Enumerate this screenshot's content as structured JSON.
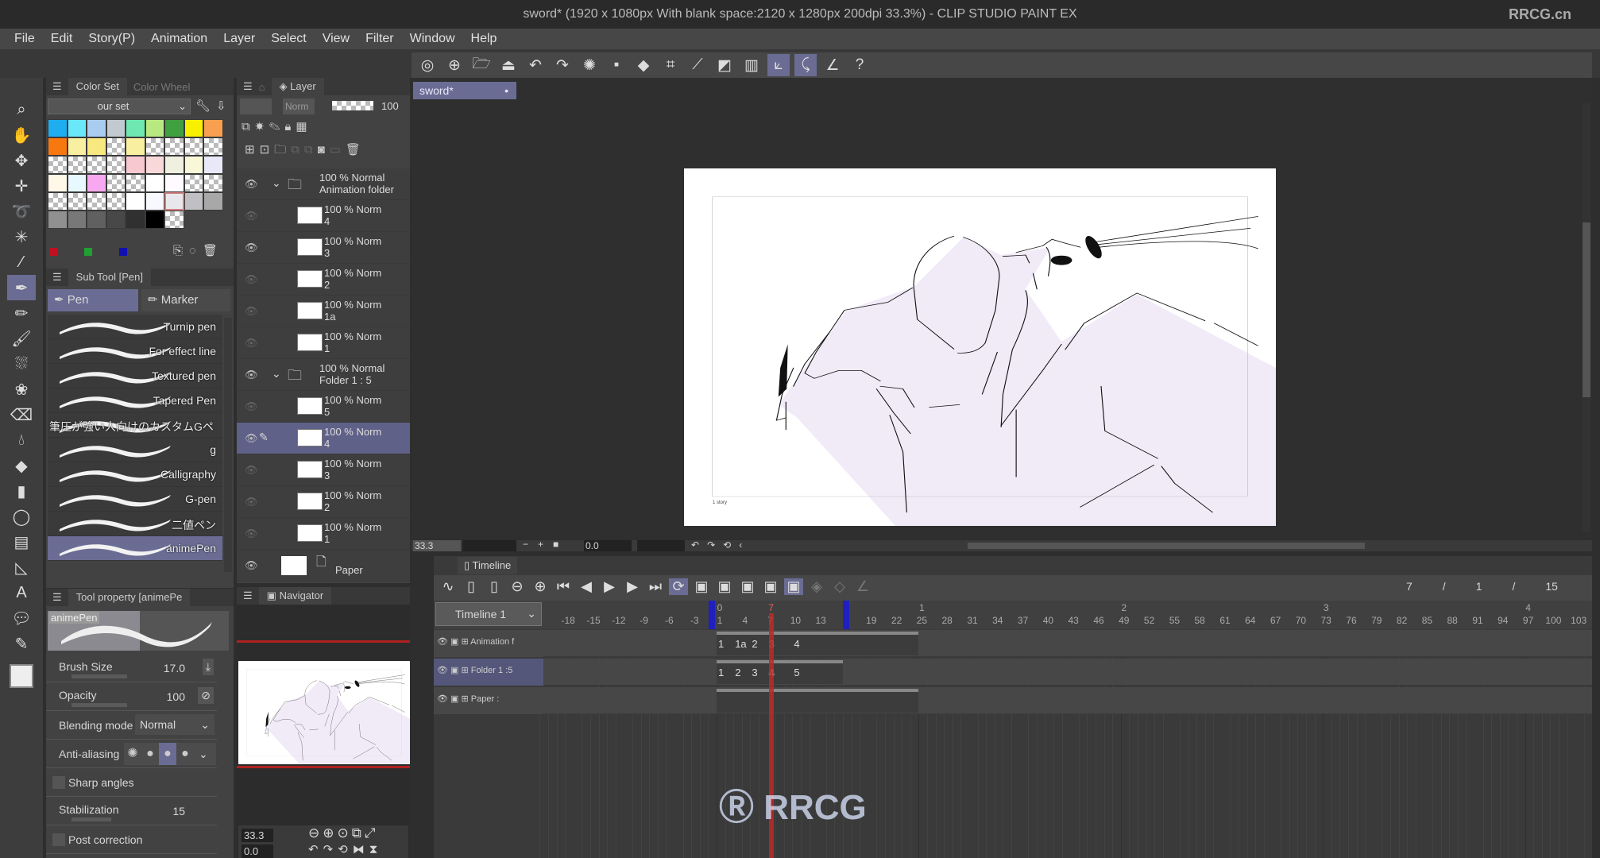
{
  "window": {
    "title": "sword* (1920 x 1080px With blank space:2120 x 1280px 200dpi 33.3%) - CLIP STUDIO PAINT EX",
    "watermark": "RRCG.cn"
  },
  "menu": [
    "File",
    "Edit",
    "Story(P)",
    "Animation",
    "Layer",
    "Select",
    "View",
    "Filter",
    "Window",
    "Help"
  ],
  "command_bar": [
    {
      "icon": "clip-studio-icon"
    },
    {
      "icon": "new-icon"
    },
    {
      "icon": "open-icon"
    },
    {
      "icon": "save-icon"
    },
    {
      "icon": "undo-icon"
    },
    {
      "icon": "redo-icon"
    },
    {
      "icon": "loading-icon"
    },
    {
      "icon": "clear-icon"
    },
    {
      "icon": "fill-icon"
    },
    {
      "icon": "transform-icon"
    },
    {
      "icon": "snap-ruler-icon"
    },
    {
      "icon": "snap-special-icon"
    },
    {
      "icon": "snap-grid-icon"
    },
    {
      "icon": "stabilize-icon",
      "active": true
    },
    {
      "icon": "stabilize-curve-icon",
      "active": true
    },
    {
      "icon": "ruler-pen-icon"
    },
    {
      "icon": "help-icon"
    }
  ],
  "tools": [
    "magnify",
    "hand",
    "move-layer",
    "move",
    "lasso",
    "auto-select",
    "eyedropper",
    "pen",
    "pencil",
    "brush",
    "airbrush",
    "decoration",
    "eraser",
    "blend",
    "fill",
    "gradient",
    "figure",
    "frame",
    "ruler",
    "text",
    "balloon",
    "line-correct"
  ],
  "active_tool": "pen",
  "color_set": {
    "tab": "Color Set",
    "tab2": "Color Wheel",
    "set_name": "our set",
    "swatches": [
      [
        "#1eaef0",
        "#68e8f8",
        "#a8cdf0",
        "#c0cad0",
        "#6ee8b0",
        "#b8e880",
        "#40a040",
        "#f8f000",
        "#f8a050"
      ],
      [
        "#f87810",
        "#f8f0a0",
        "#f8e880",
        "chk",
        "#f8f0a0",
        "chk",
        "chk",
        "chk",
        "chk"
      ],
      [
        "chk",
        "chk",
        "chk",
        "chk",
        "#f8c8d0",
        "#f8d8d8",
        "#f0f0e0",
        "#f8f8d8",
        "#e8e8f8"
      ],
      [
        "#fff8e8",
        "#e8f8ff",
        "#f8a8f0",
        "chk",
        "chk",
        "#ffffff",
        "#fffaff",
        "chk",
        "chk"
      ],
      [
        "chk",
        "chk",
        "chk",
        "chk",
        "#ffffff",
        "#f8f8ff",
        "#e8e8ec",
        "#c0c0c4",
        "#a8a8a8"
      ],
      [
        "#909090",
        "#787878",
        "#606060",
        "#484848",
        "#303030",
        "#000000",
        "chk",
        "",
        ""
      ]
    ],
    "rgb": [
      "#c01020",
      "#20a030",
      "#1010b0"
    ]
  },
  "sub_tool": {
    "tab": "Sub Tool [Pen]",
    "groups": [
      "Pen",
      "Marker"
    ],
    "active_group": "Pen",
    "brushes": [
      "Turnip pen",
      "For effect line",
      "Textured pen",
      "Tapered Pen",
      "筆圧が強い人向けのカスタムGペン",
      "g",
      "Calligraphy",
      "G-pen",
      "二値ペン",
      "animePen"
    ],
    "selected": "animePen"
  },
  "tool_property": {
    "tab": "Tool property [animePe",
    "preview_label": "animePen",
    "brush_size": {
      "label": "Brush Size",
      "value": "17.0"
    },
    "opacity": {
      "label": "Opacity",
      "value": "100"
    },
    "blending": {
      "label": "Blending mode",
      "value": "Normal"
    },
    "anti_aliasing": {
      "label": "Anti-aliasing",
      "level": 3
    },
    "sharp_angles": {
      "label": "Sharp angles",
      "checked": false
    },
    "stabilization": {
      "label": "Stabilization",
      "value": "15"
    },
    "post_correction": {
      "label": "Post correction",
      "checked": false
    }
  },
  "layer_panel": {
    "tab": "Layer",
    "blend": "Norm",
    "opacity": "100",
    "layers": [
      {
        "pct": "100 % Normal",
        "name": "Animation folder",
        "folder": true,
        "visible": true
      },
      {
        "pct": "100 % Norm",
        "name": "4",
        "visible": false
      },
      {
        "pct": "100 % Norm",
        "name": "3",
        "visible": true
      },
      {
        "pct": "100 % Norm",
        "name": "2",
        "visible": false
      },
      {
        "pct": "100 % Norm",
        "name": "1a",
        "visible": false
      },
      {
        "pct": "100 % Norm",
        "name": "1",
        "visible": false
      },
      {
        "pct": "100 % Normal",
        "name": "Folder 1 : 5",
        "folder": true,
        "visible": true
      },
      {
        "pct": "100 % Norm",
        "name": "5",
        "visible": false
      },
      {
        "pct": "100 % Norm",
        "name": "4",
        "visible": true,
        "selected": true
      },
      {
        "pct": "100 % Norm",
        "name": "3",
        "visible": false
      },
      {
        "pct": "100 % Norm",
        "name": "2",
        "visible": false
      },
      {
        "pct": "100 % Norm",
        "name": "1",
        "visible": false
      },
      {
        "pct": "",
        "name": "Paper",
        "paper": true,
        "visible": true
      }
    ]
  },
  "navigator": {
    "tab": "Navigator",
    "zoom": "33.3",
    "angle": "0.0"
  },
  "document": {
    "tab": "sword*",
    "frame_caption": "1 story"
  },
  "canvas_status": {
    "zoom": "33.3",
    "angle": "0.0"
  },
  "timeline": {
    "tab": "Timeline",
    "name": "Timeline 1",
    "current_frame": "7",
    "sep": "/",
    "start": "1",
    "end": "15",
    "playhead": 7,
    "range": [
      1,
      15
    ],
    "ruler_frames": [
      -18,
      -15,
      -12,
      -9,
      -6,
      -3,
      1,
      4,
      7,
      10,
      13,
      19,
      22,
      25,
      28,
      31,
      34,
      37,
      40,
      43,
      46,
      49,
      52,
      55,
      58,
      61,
      64,
      67,
      70,
      73,
      76,
      79,
      82,
      85,
      88,
      91,
      94,
      97,
      100,
      103
    ],
    "seconds": [
      {
        "label": "0",
        "frame": 1
      },
      {
        "label": "1",
        "frame": 25
      },
      {
        "label": "2",
        "frame": 49
      },
      {
        "label": "3",
        "frame": 73
      },
      {
        "label": "4",
        "frame": 97
      }
    ],
    "tracks": [
      {
        "name": "Animation f",
        "span": [
          1,
          24
        ],
        "cels": [
          {
            "label": "1",
            "frame": 1
          },
          {
            "label": "1a",
            "frame": 3
          },
          {
            "label": "2",
            "frame": 5
          },
          {
            "label": "3",
            "frame": 7
          },
          {
            "label": "4",
            "frame": 10
          }
        ]
      },
      {
        "name": "Folder 1 :5",
        "span": [
          1,
          15
        ],
        "cels": [
          {
            "label": "1",
            "frame": 1
          },
          {
            "label": "2",
            "frame": 3
          },
          {
            "label": "3",
            "frame": 5
          },
          {
            "label": "4",
            "frame": 7
          },
          {
            "label": "5",
            "frame": 10
          }
        ]
      },
      {
        "name": "Paper :",
        "span": [
          1,
          24
        ],
        "cels": []
      }
    ]
  },
  "colors": {
    "accent": "#6a6c94",
    "playhead": "#c02828",
    "range_marker": "#2020c0",
    "panel": "#424242"
  }
}
